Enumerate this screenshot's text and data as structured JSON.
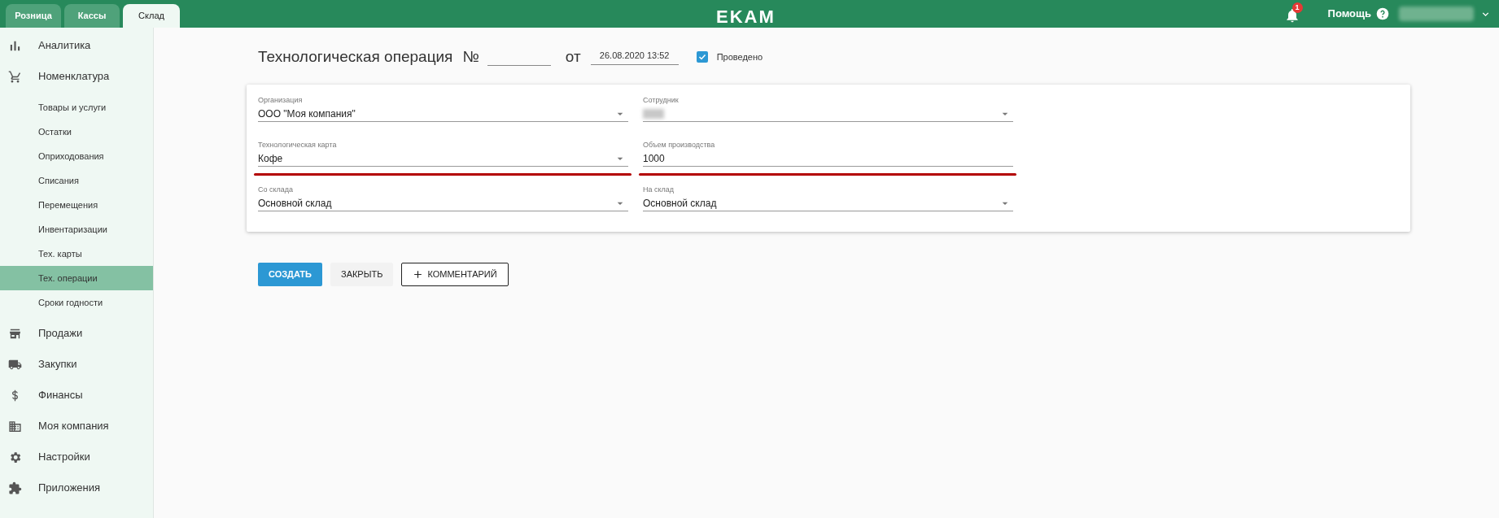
{
  "top_tabs": [
    {
      "label": "Розница",
      "selected": false
    },
    {
      "label": "Кассы",
      "selected": false
    },
    {
      "label": "Склад",
      "selected": true
    }
  ],
  "logo": "EKAM",
  "notifications": {
    "count": "1"
  },
  "help": {
    "label": "Помощь"
  },
  "sidebar": {
    "items": [
      {
        "label": "Аналитика",
        "selected": false
      },
      {
        "label": "Номенклатура",
        "selected": false,
        "children": [
          {
            "label": "Товары и услуги",
            "selected": false
          },
          {
            "label": "Остатки",
            "selected": false
          },
          {
            "label": "Оприходования",
            "selected": false
          },
          {
            "label": "Списания",
            "selected": false
          },
          {
            "label": "Перемещения",
            "selected": false
          },
          {
            "label": "Инвентаризации",
            "selected": false
          },
          {
            "label": "Тех. карты",
            "selected": false
          },
          {
            "label": "Тех. операции",
            "selected": true
          },
          {
            "label": "Сроки годности",
            "selected": false
          }
        ]
      },
      {
        "label": "Продажи",
        "selected": false
      },
      {
        "label": "Закупки",
        "selected": false
      },
      {
        "label": "Финансы",
        "selected": false
      },
      {
        "label": "Моя компания",
        "selected": false
      },
      {
        "label": "Настройки",
        "selected": false
      },
      {
        "label": "Приложения",
        "selected": false
      }
    ]
  },
  "document": {
    "title": "Технологическая операция",
    "number_label": "№",
    "date_label": "от",
    "date": "26.08.2020 13:52",
    "posted": {
      "label": "Проведено",
      "checked": true
    }
  },
  "fields": [
    {
      "label": "Организация",
      "value": "ООО \"Моя компания\"",
      "kind": "select",
      "highlighted": false
    },
    {
      "label": "Сотрудник",
      "kind": "select",
      "highlighted": false
    },
    {
      "label": "Технологическая карта",
      "value": "Кофе",
      "kind": "select",
      "highlighted": true
    },
    {
      "label": "Объем производства",
      "value": "1000",
      "kind": "input",
      "highlighted": true
    },
    {
      "label": "Со склада",
      "value": "Основной склад",
      "kind": "select",
      "highlighted": false
    },
    {
      "label": "На склад",
      "value": "Основной склад",
      "kind": "select",
      "highlighted": false
    }
  ],
  "buttons": [
    {
      "label": "СОЗДАТЬ",
      "kind": "primary"
    },
    {
      "label": "ЗАКРЫТЬ",
      "kind": "flat"
    },
    {
      "label": "КОММЕНТАРИЙ",
      "kind": "outlined"
    }
  ]
}
